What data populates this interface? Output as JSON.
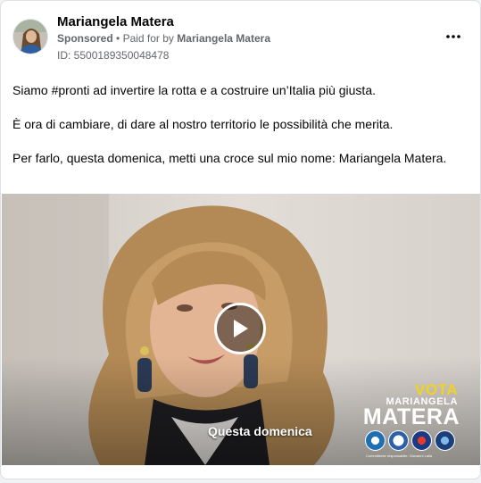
{
  "post": {
    "page_name": "Mariangela Matera",
    "sponsored_label": "Sponsored",
    "separator": "•",
    "paid_for_prefix": "Paid for by",
    "paid_for_by": "Mariangela Matera",
    "ad_id": "ID: 5500189350048478",
    "more_icon": "more-horizontal-icon",
    "body": [
      "Siamo #pronti ad invertire la rotta e a costruire un’Italia più giusta.",
      "È ora di cambiare, di dare al nostro territorio le possibilità che merita.",
      "Per farlo, questa domenica, metti una croce sul mio nome: Mariangela Matera."
    ]
  },
  "video": {
    "play_icon": "play-icon",
    "caption": "Questa domenica",
    "overlay": {
      "vota": "VOTA",
      "first_name": "MARIANGELA",
      "last_name": "MATERA",
      "committee": "Committente responsabile: Giovanni Lalla"
    }
  },
  "colors": {
    "vota_yellow": "#f2d21b",
    "text_primary": "#050505",
    "text_secondary": "#65676b"
  }
}
